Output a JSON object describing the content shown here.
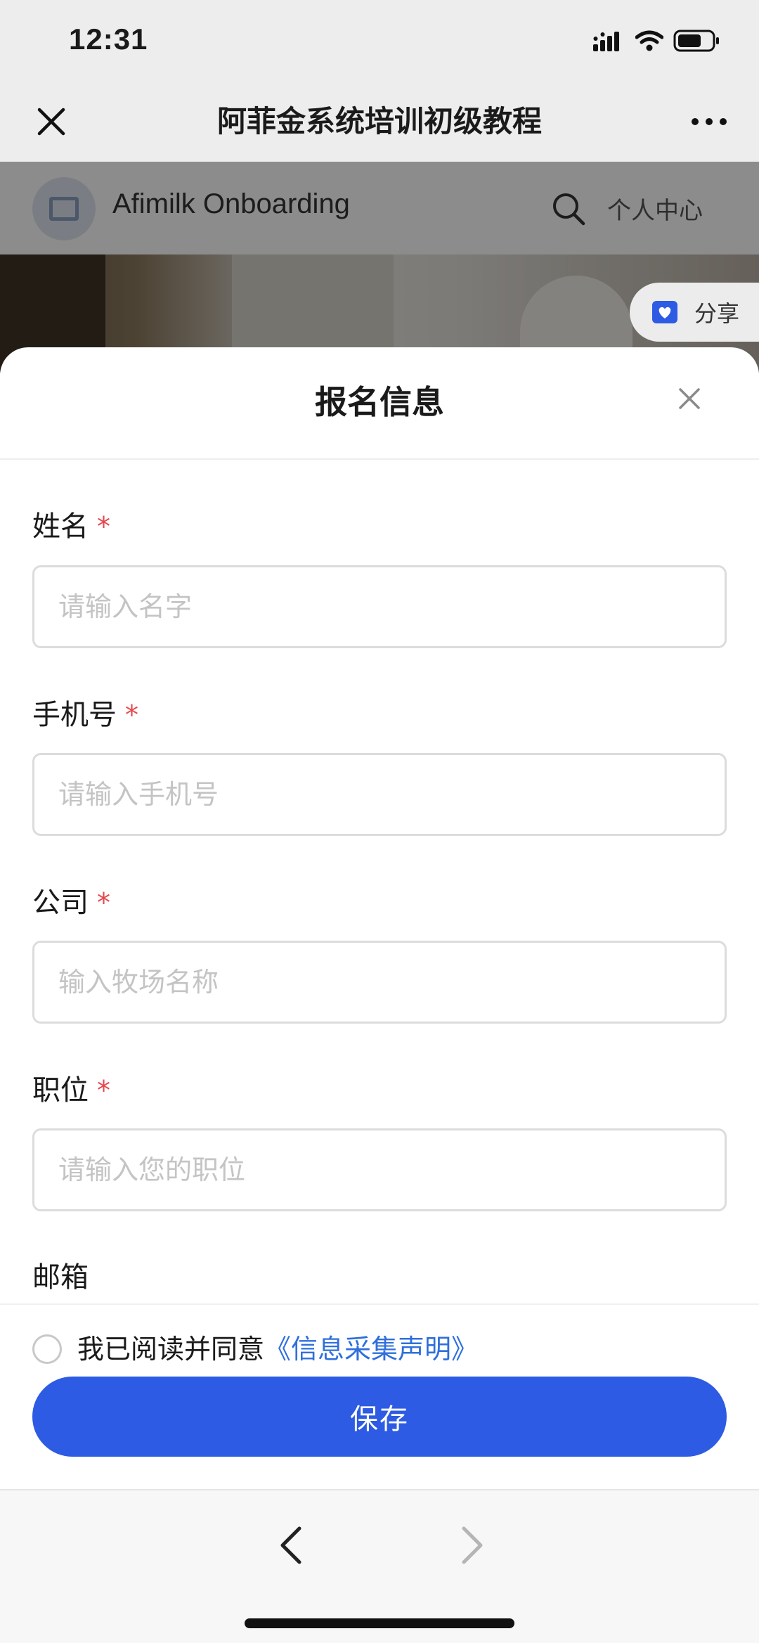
{
  "status_bar": {
    "time": "12:31"
  },
  "nav": {
    "title": "阿菲金系统培训初级教程"
  },
  "site": {
    "name": "Afimilk Onboarding",
    "user_center": "个人中心"
  },
  "share": {
    "label": "分享"
  },
  "sheet": {
    "title": "报名信息",
    "fields": [
      {
        "label": "姓名",
        "required": "*",
        "placeholder": "请输入名字"
      },
      {
        "label": "手机号",
        "required": "*",
        "placeholder": "请输入手机号"
      },
      {
        "label": "公司",
        "required": "*",
        "placeholder": "输入牧场名称"
      },
      {
        "label": "职位",
        "required": "*",
        "placeholder": "请输入您的职位"
      },
      {
        "label": "邮箱"
      }
    ]
  },
  "agreement": {
    "text": "我已阅读并同意",
    "link": "《信息采集声明》"
  },
  "actions": {
    "save": "保存"
  },
  "colors": {
    "primary": "#2d5be3",
    "link": "#2f6fdc",
    "required": "#e5484d"
  }
}
